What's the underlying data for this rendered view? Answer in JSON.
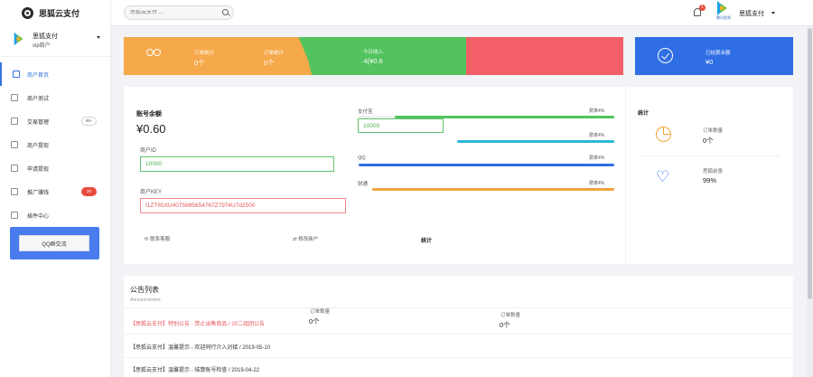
{
  "header": {
    "brand": "思狐云支付",
    "search_placeholder": "思狐云支付 ...",
    "notification_count": "1",
    "avatar_caption": "腾讯视频",
    "user_name": "思狐支付"
  },
  "sidebar": {
    "user_name": "思狐支付",
    "user_role": "vip商户",
    "items": [
      {
        "label": "商户首页",
        "active": true
      },
      {
        "label": "商户测试"
      },
      {
        "label": "交易管理",
        "badge": "99+"
      },
      {
        "label": "商户提现"
      },
      {
        "label": "申请提现"
      },
      {
        "label": "推广赚钱",
        "badge": "20"
      },
      {
        "label": "插件中心"
      }
    ],
    "qq_button": "QQ群交流"
  },
  "cards": {
    "orange": {
      "label1": "订单统计",
      "value1": "0个",
      "label2": "订单统计",
      "value2": "0个"
    },
    "green": {
      "label": "今日收入",
      "value": "¥0.6",
      "prefix": "4("
    },
    "blue": {
      "label": "已结算余额",
      "value": "¥0"
    }
  },
  "account": {
    "title": "账号余额",
    "balance": "¥0.60",
    "pid_label": "商户ID",
    "pid_value": "10000",
    "pkey_label": "商户KEY",
    "pkey_value": "I1ZT65XU4075685654767Z7974U7d2500",
    "contact_link": "联系客服",
    "edit_link": "修改商户"
  },
  "payments": {
    "rows": [
      {
        "name": "支付宝",
        "rate": "费率4%",
        "color": "#52c35e"
      },
      {
        "name": "",
        "rate": "费率4%",
        "color": "#2bb7d6"
      },
      {
        "name": "QQ",
        "rate": "费率4%",
        "color": "#2f6ee4"
      },
      {
        "name": "财通",
        "rate": "费率4%",
        "color": "#f2a33c"
      }
    ],
    "input_value": "10000",
    "stat_label": "统计"
  },
  "stats": {
    "title": "统计",
    "order_label": "订单数量",
    "order_value": "0个",
    "rate_label": "思狐前景",
    "rate_value": "99%"
  },
  "announcement": {
    "title": "公告列表",
    "subtitle": "Announcement",
    "items": [
      {
        "text": "【思狐云支付】特别公告 - 禁止出售商品 / 20二组团公告",
        "red": true
      },
      {
        "text": "【思狐云支付】温馨提示 - 欢迎同行介入对接 / 2019-05-10"
      },
      {
        "text": "【思狐云支付】温馨提示 - 结算账号检查 / 2019-04-22"
      }
    ],
    "stat1_label": "订单数量",
    "stat1_value": "0个",
    "stat2_label": "订单数量",
    "stat2_value": "0个"
  }
}
